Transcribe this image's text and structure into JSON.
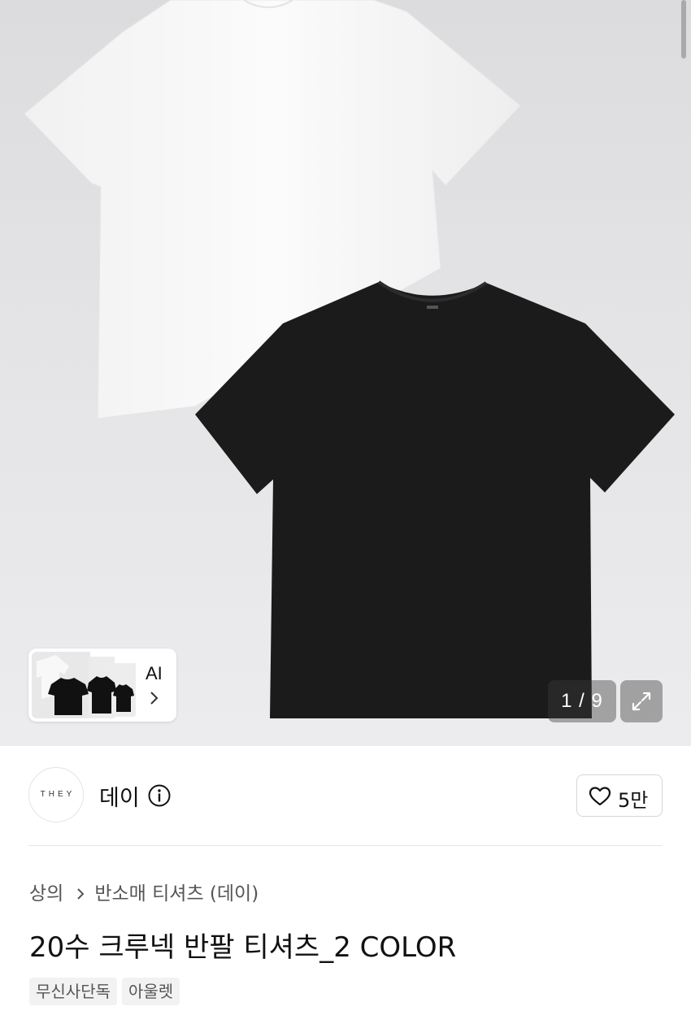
{
  "gallery": {
    "page_counter": "1 / 9",
    "current_page": 1,
    "total_pages": 9,
    "ai_button_label": "AI",
    "expand_icon": "expand-arrows-icon"
  },
  "brand": {
    "logo_text": "THEY",
    "name": "데이",
    "info_icon": "info-circle-icon"
  },
  "like": {
    "icon": "heart-outline-icon",
    "count": "5만"
  },
  "breadcrumb": {
    "category": "상의",
    "subcategory": "반소매 티셔츠 (데이)"
  },
  "product": {
    "title": "20수 크루넥 반팔 티셔츠_2 COLOR"
  },
  "tags": [
    "무신사단독",
    "아울렛"
  ],
  "colors": {
    "background_gradient_top": "#dcdcde",
    "white_shirt": "#f7f7f7",
    "black_shirt": "#1b1b1b"
  }
}
